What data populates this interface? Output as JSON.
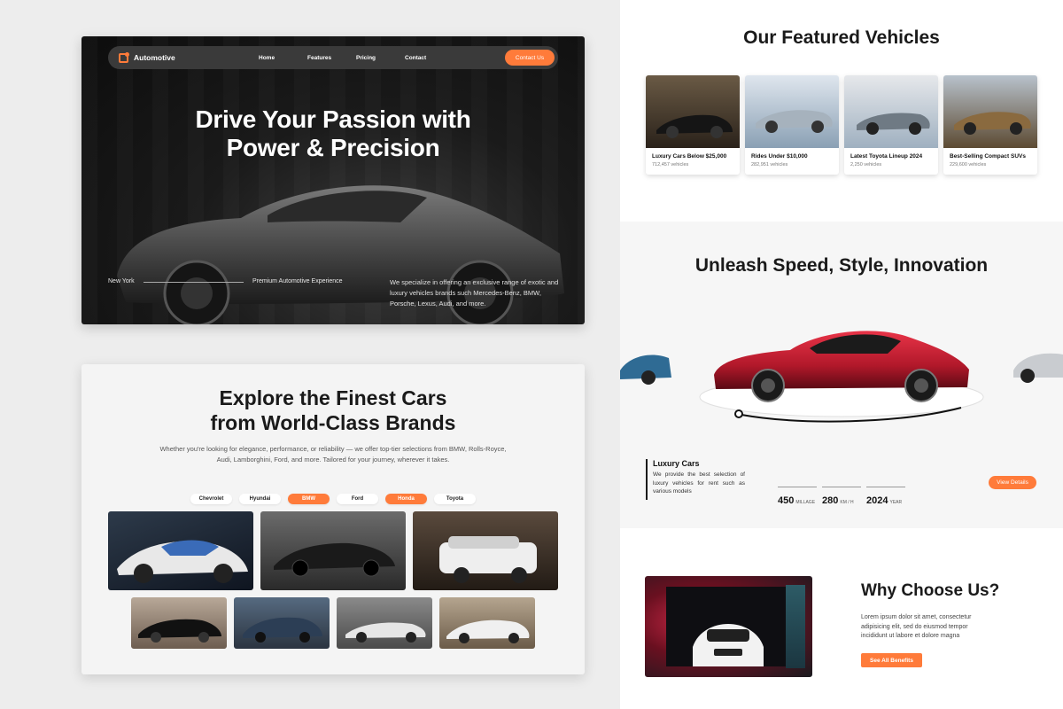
{
  "hero": {
    "logo": "Automotive",
    "nav": [
      "Home",
      "Features",
      "Pricing",
      "Contact"
    ],
    "contact_button": "Contact Us",
    "title_line1": "Drive Your Passion with",
    "title_line2": "Power & Precision",
    "location": "New York",
    "tagline": "Premium Automotive Experience",
    "description": "We specialize in offering an exclusive range of exotic and luxury vehicles  brands such Mercedes-Benz, BMW, Porsche, Lexus, Audi, and more."
  },
  "explore": {
    "title_line1": "Explore the Finest Cars",
    "title_line2": "from World-Class Brands",
    "subtitle": "Whether you're looking for elegance, performance, or reliability — we offer top-tier selections from BMW, Rolls-Royce, Audi, Lamborghini, Ford, and more. Tailored for your journey, wherever it takes.",
    "brands": [
      {
        "label": "Chevrolet",
        "active": false
      },
      {
        "label": "Hyundai",
        "active": false
      },
      {
        "label": "BMW",
        "active": true
      },
      {
        "label": "Ford",
        "active": false
      },
      {
        "label": "Honda",
        "active": true
      },
      {
        "label": "Toyota",
        "active": false
      }
    ]
  },
  "featured": {
    "title": "Our Featured Vehicles",
    "cards": [
      {
        "title": "Luxury Cars Below $25,000",
        "count": "712,457 vehicles"
      },
      {
        "title": "Rides Under $10,000",
        "count": "282,951 vehicles"
      },
      {
        "title": "Latest Toyota Lineup 2024",
        "count": "2,250 vehicles"
      },
      {
        "title": "Best-Selling Compact SUVs",
        "count": "229,600 vehicles"
      }
    ]
  },
  "unleash": {
    "title": "Unleash Speed, Style, Innovation",
    "car_name": "Luxury Cars",
    "car_desc": "We provide the best selection of luxury vehicles for rent such as various models",
    "stats": [
      {
        "value": "450",
        "unit": "MILLAGE"
      },
      {
        "value": "280",
        "unit": "KM / H"
      },
      {
        "value": "2024",
        "unit": "YEAR"
      }
    ],
    "details_button": "View Details"
  },
  "why": {
    "title": "Why Choose Us?",
    "description": "Lorem ipsum dolor sit amet, consectetur adipisicing elit, sed do eiusmod tempor incididunt ut labore et dolore magna",
    "button": "See All Benefits"
  },
  "colors": {
    "accent": "#ff7b3a",
    "dark": "#111111",
    "red_car": "#c3182a"
  }
}
